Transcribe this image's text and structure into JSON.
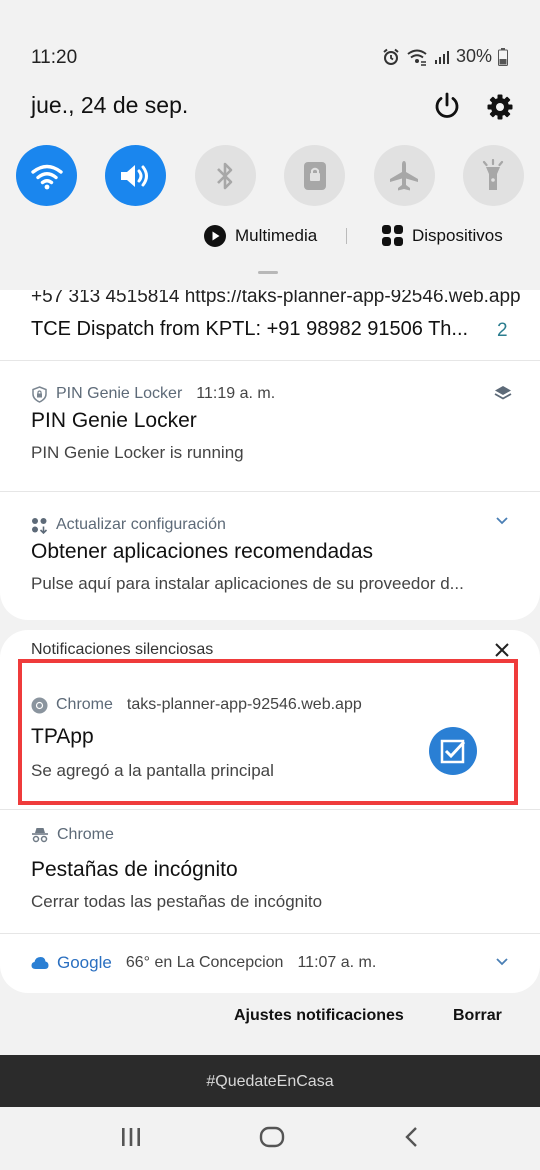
{
  "status_bar": {
    "time": "11:20",
    "battery_percent": "30%",
    "icons": [
      "alarm-icon",
      "wifi-calling-icon",
      "signal-icon",
      "battery-icon"
    ]
  },
  "header": {
    "date": "jue., 24 de sep.",
    "icons": [
      "power-icon",
      "settings-icon"
    ]
  },
  "quick_settings": [
    {
      "name": "wifi",
      "icon": "wifi-icon",
      "state": "on"
    },
    {
      "name": "sound",
      "icon": "volume-icon",
      "state": "on"
    },
    {
      "name": "bluetooth",
      "icon": "bluetooth-icon",
      "state": "off"
    },
    {
      "name": "rotation-lock",
      "icon": "rotation-lock-icon",
      "state": "off"
    },
    {
      "name": "airplane-mode",
      "icon": "airplane-icon",
      "state": "off"
    },
    {
      "name": "flashlight",
      "icon": "flashlight-icon",
      "state": "off"
    }
  ],
  "media": {
    "multimedia_label": "Multimedia",
    "devices_label": "Dispositivos"
  },
  "notifications": {
    "partial": {
      "line1": "+57 313 4515814 https://taks-planner-app-92546.web.app",
      "title": "TCE Dispatch from KPTL: +91 98982 91506 Th...",
      "count": "2"
    },
    "pin_genie": {
      "app": "PIN Genie Locker",
      "time": "11:19 a. m.",
      "title": "PIN Genie Locker",
      "body": "PIN Genie Locker is running"
    },
    "update": {
      "app": "Actualizar configuración",
      "title": "Obtener aplicaciones recomendadas",
      "body": "Pulse aquí para instalar aplicaciones de su proveedor d..."
    },
    "silent_section_label": "Notificaciones silenciosas",
    "chrome_tpapp": {
      "app": "Chrome",
      "site": "taks-planner-app-92546.web.app",
      "title": "TPApp",
      "body": "Se agregó a la pantalla principal"
    },
    "chrome_incognito": {
      "app": "Chrome",
      "title": "Pestañas de incógnito",
      "body": "Cerrar todas las pestañas de incógnito"
    },
    "google": {
      "app": "Google",
      "weather": "66° en La Concepcion",
      "time": "11:07 a. m."
    }
  },
  "footer": {
    "settings_label": "Ajustes notificaciones",
    "clear_label": "Borrar"
  },
  "hashtag": "#QuedateEnCasa",
  "colors": {
    "accent": "#1a86ee",
    "highlight": "#ef3b3b",
    "panel": "#ffffff",
    "background": "#f2f2f2"
  }
}
